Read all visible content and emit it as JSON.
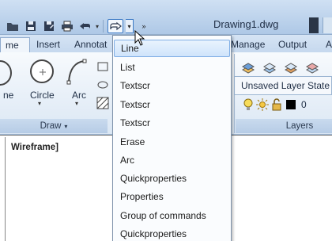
{
  "title_bar": {
    "document": "Drawing1.dwg"
  },
  "tabs": [
    "me",
    "Insert",
    "Annotat",
    "Manage",
    "Output",
    "A"
  ],
  "ribbon": {
    "draw_tools": [
      "ne",
      "Circle",
      "Arc"
    ],
    "draw_panel": "Draw",
    "layer_state": "Unsaved Layer State",
    "layer_value": "0",
    "layers_panel": "Layers"
  },
  "viewport": {
    "label": "Wireframe]"
  },
  "menu": {
    "items": [
      "Line",
      "List",
      "Textscr",
      "Textscr",
      "Textscr",
      "Erase",
      "Arc",
      "Quickproperties",
      "Properties",
      "Group of commands",
      "Quickproperties"
    ],
    "selected_index": 0
  },
  "colors": {
    "accent": "#3d7bc6",
    "menu_selected": "#cfe4fb",
    "ribbon": "#dbe7f4"
  }
}
